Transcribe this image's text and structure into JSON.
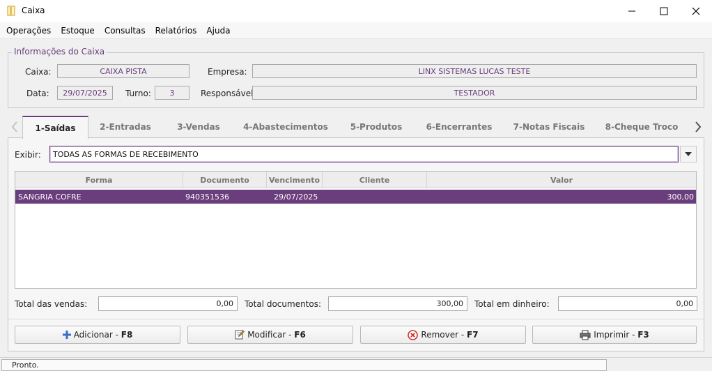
{
  "window": {
    "title": "Caixa"
  },
  "menu": [
    "Operações",
    "Estoque",
    "Consultas",
    "Relatórios",
    "Ajuda"
  ],
  "info": {
    "legend": "Informações do Caixa",
    "caixa_label": "Caixa:",
    "caixa_value": "CAIXA PISTA",
    "empresa_label": "Empresa:",
    "empresa_value": "LINX SISTEMAS LUCAS TESTE",
    "data_label": "Data:",
    "data_value": "29/07/2025",
    "turno_label": "Turno:",
    "turno_value": "3",
    "responsavel_label": "Responsável:",
    "responsavel_value": "TESTADOR"
  },
  "tabs": [
    "1-Saídas",
    "2-Entradas",
    "3-Vendas",
    "4-Abastecimentos",
    "5-Produtos",
    "6-Encerrantes",
    "7-Notas Fiscais",
    "8-Cheque Troco"
  ],
  "filter": {
    "label": "Exibir:",
    "value": "TODAS AS FORMAS DE RECEBIMENTO"
  },
  "grid": {
    "columns": [
      "Forma",
      "Documento",
      "Vencimento",
      "Cliente",
      "Valor"
    ],
    "rows": [
      {
        "forma": "SANGRIA COFRE",
        "documento": "940351536",
        "vencimento": "29/07/2025",
        "cliente": "",
        "valor": "300,00"
      }
    ]
  },
  "totals": {
    "vendas_label": "Total das vendas:",
    "vendas_value": "0,00",
    "documentos_label": "Total documentos:",
    "documentos_value": "300,00",
    "dinheiro_label": "Total em dinheiro:",
    "dinheiro_value": "0,00"
  },
  "actions": {
    "add_label": "Adicionar - ",
    "add_key": "F8",
    "edit_label": "Modificar - ",
    "edit_key": "F6",
    "remove_label": "Remover - ",
    "remove_key": "F7",
    "print_label": "Imprimir - ",
    "print_key": "F3"
  },
  "status": {
    "text": "Pronto."
  },
  "colors": {
    "accent": "#6a3d7c",
    "add_icon": "#3a6fc4",
    "remove_icon": "#d03030"
  }
}
